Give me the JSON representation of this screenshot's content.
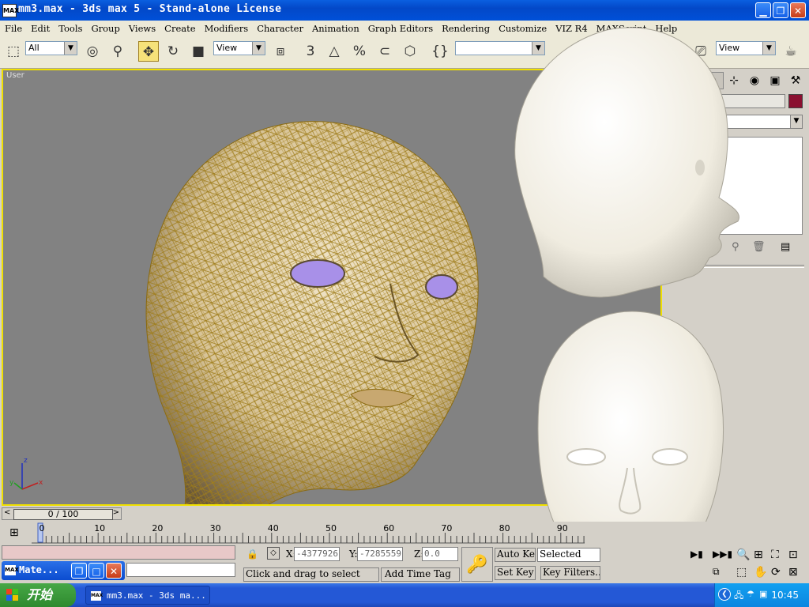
{
  "window": {
    "app_icon_text": "MAX",
    "title": "mm3.max - 3ds max 5 - Stand-alone License"
  },
  "menu": [
    "File",
    "Edit",
    "Tools",
    "Group",
    "Views",
    "Create",
    "Modifiers",
    "Character",
    "Animation",
    "Graph Editors",
    "Rendering",
    "Customize",
    "VIZ R4",
    "MAXScript",
    "Help"
  ],
  "toolbar": {
    "selection_filter": "All",
    "ref_coord": "View",
    "ref_coord_right": "View",
    "snap_label": "3"
  },
  "viewport": {
    "label": "User",
    "axis_x": "x",
    "axis_y": "y",
    "axis_z": "z"
  },
  "timeline": {
    "slider_text": "0 / 100",
    "ticks": [
      "0",
      "10",
      "20",
      "30",
      "40",
      "50",
      "60",
      "70",
      "80",
      "90"
    ]
  },
  "status": {
    "x_label": "X:",
    "x_value": "-4377926",
    "y_label": "Y:",
    "y_value": "-7285559",
    "z_label": "Z:",
    "z_value": "0.0",
    "prompt": "Click and drag to select",
    "add_time_tag": "Add Time Tag",
    "auto_key": "Auto Key",
    "set_key": "Set Key",
    "selected": "Selected",
    "key_filters": "Key Filters..."
  },
  "mat_window": {
    "icon": "MAX",
    "label": "Mate..."
  },
  "taskbar": {
    "start": "开始",
    "task": "mm3.max - 3ds ma...",
    "task_icon": "MAX",
    "clock": "10:45"
  },
  "colors": {
    "viewport_bg": "#828282",
    "active_border": "#f0e000",
    "xp_blue": "#0348c8",
    "mesh": "#9c7a18",
    "skin": "#e8d8b8",
    "eye": "#a890e8"
  }
}
